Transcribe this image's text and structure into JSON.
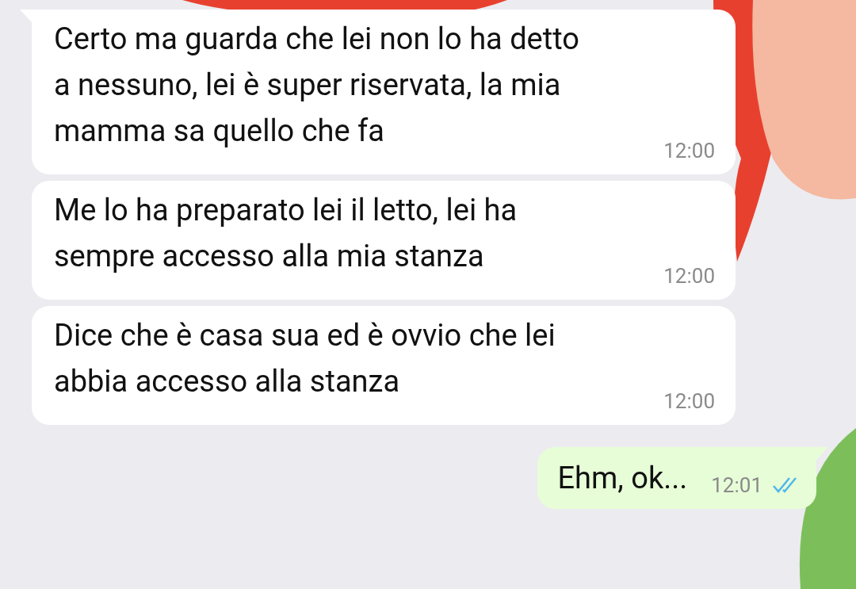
{
  "messages": [
    {
      "kind": "incoming",
      "tail": true,
      "text": "Certo ma guarda che lei non lo ha detto a nessuno, lei è super riservata, la mia mamma sa quello che fa",
      "time": "12:00"
    },
    {
      "kind": "incoming",
      "tail": false,
      "text": "Me lo ha preparato lei il letto, lei ha sempre accesso alla mia stanza\n",
      "time": "12:00"
    },
    {
      "kind": "incoming",
      "tail": false,
      "text": "Dice che è casa sua ed è ovvio che lei abbia accesso alla stanza",
      "time": "12:00"
    },
    {
      "kind": "outgoing",
      "tail": true,
      "text": "Ehm, ok...",
      "time": "12:01",
      "read": true
    }
  ]
}
